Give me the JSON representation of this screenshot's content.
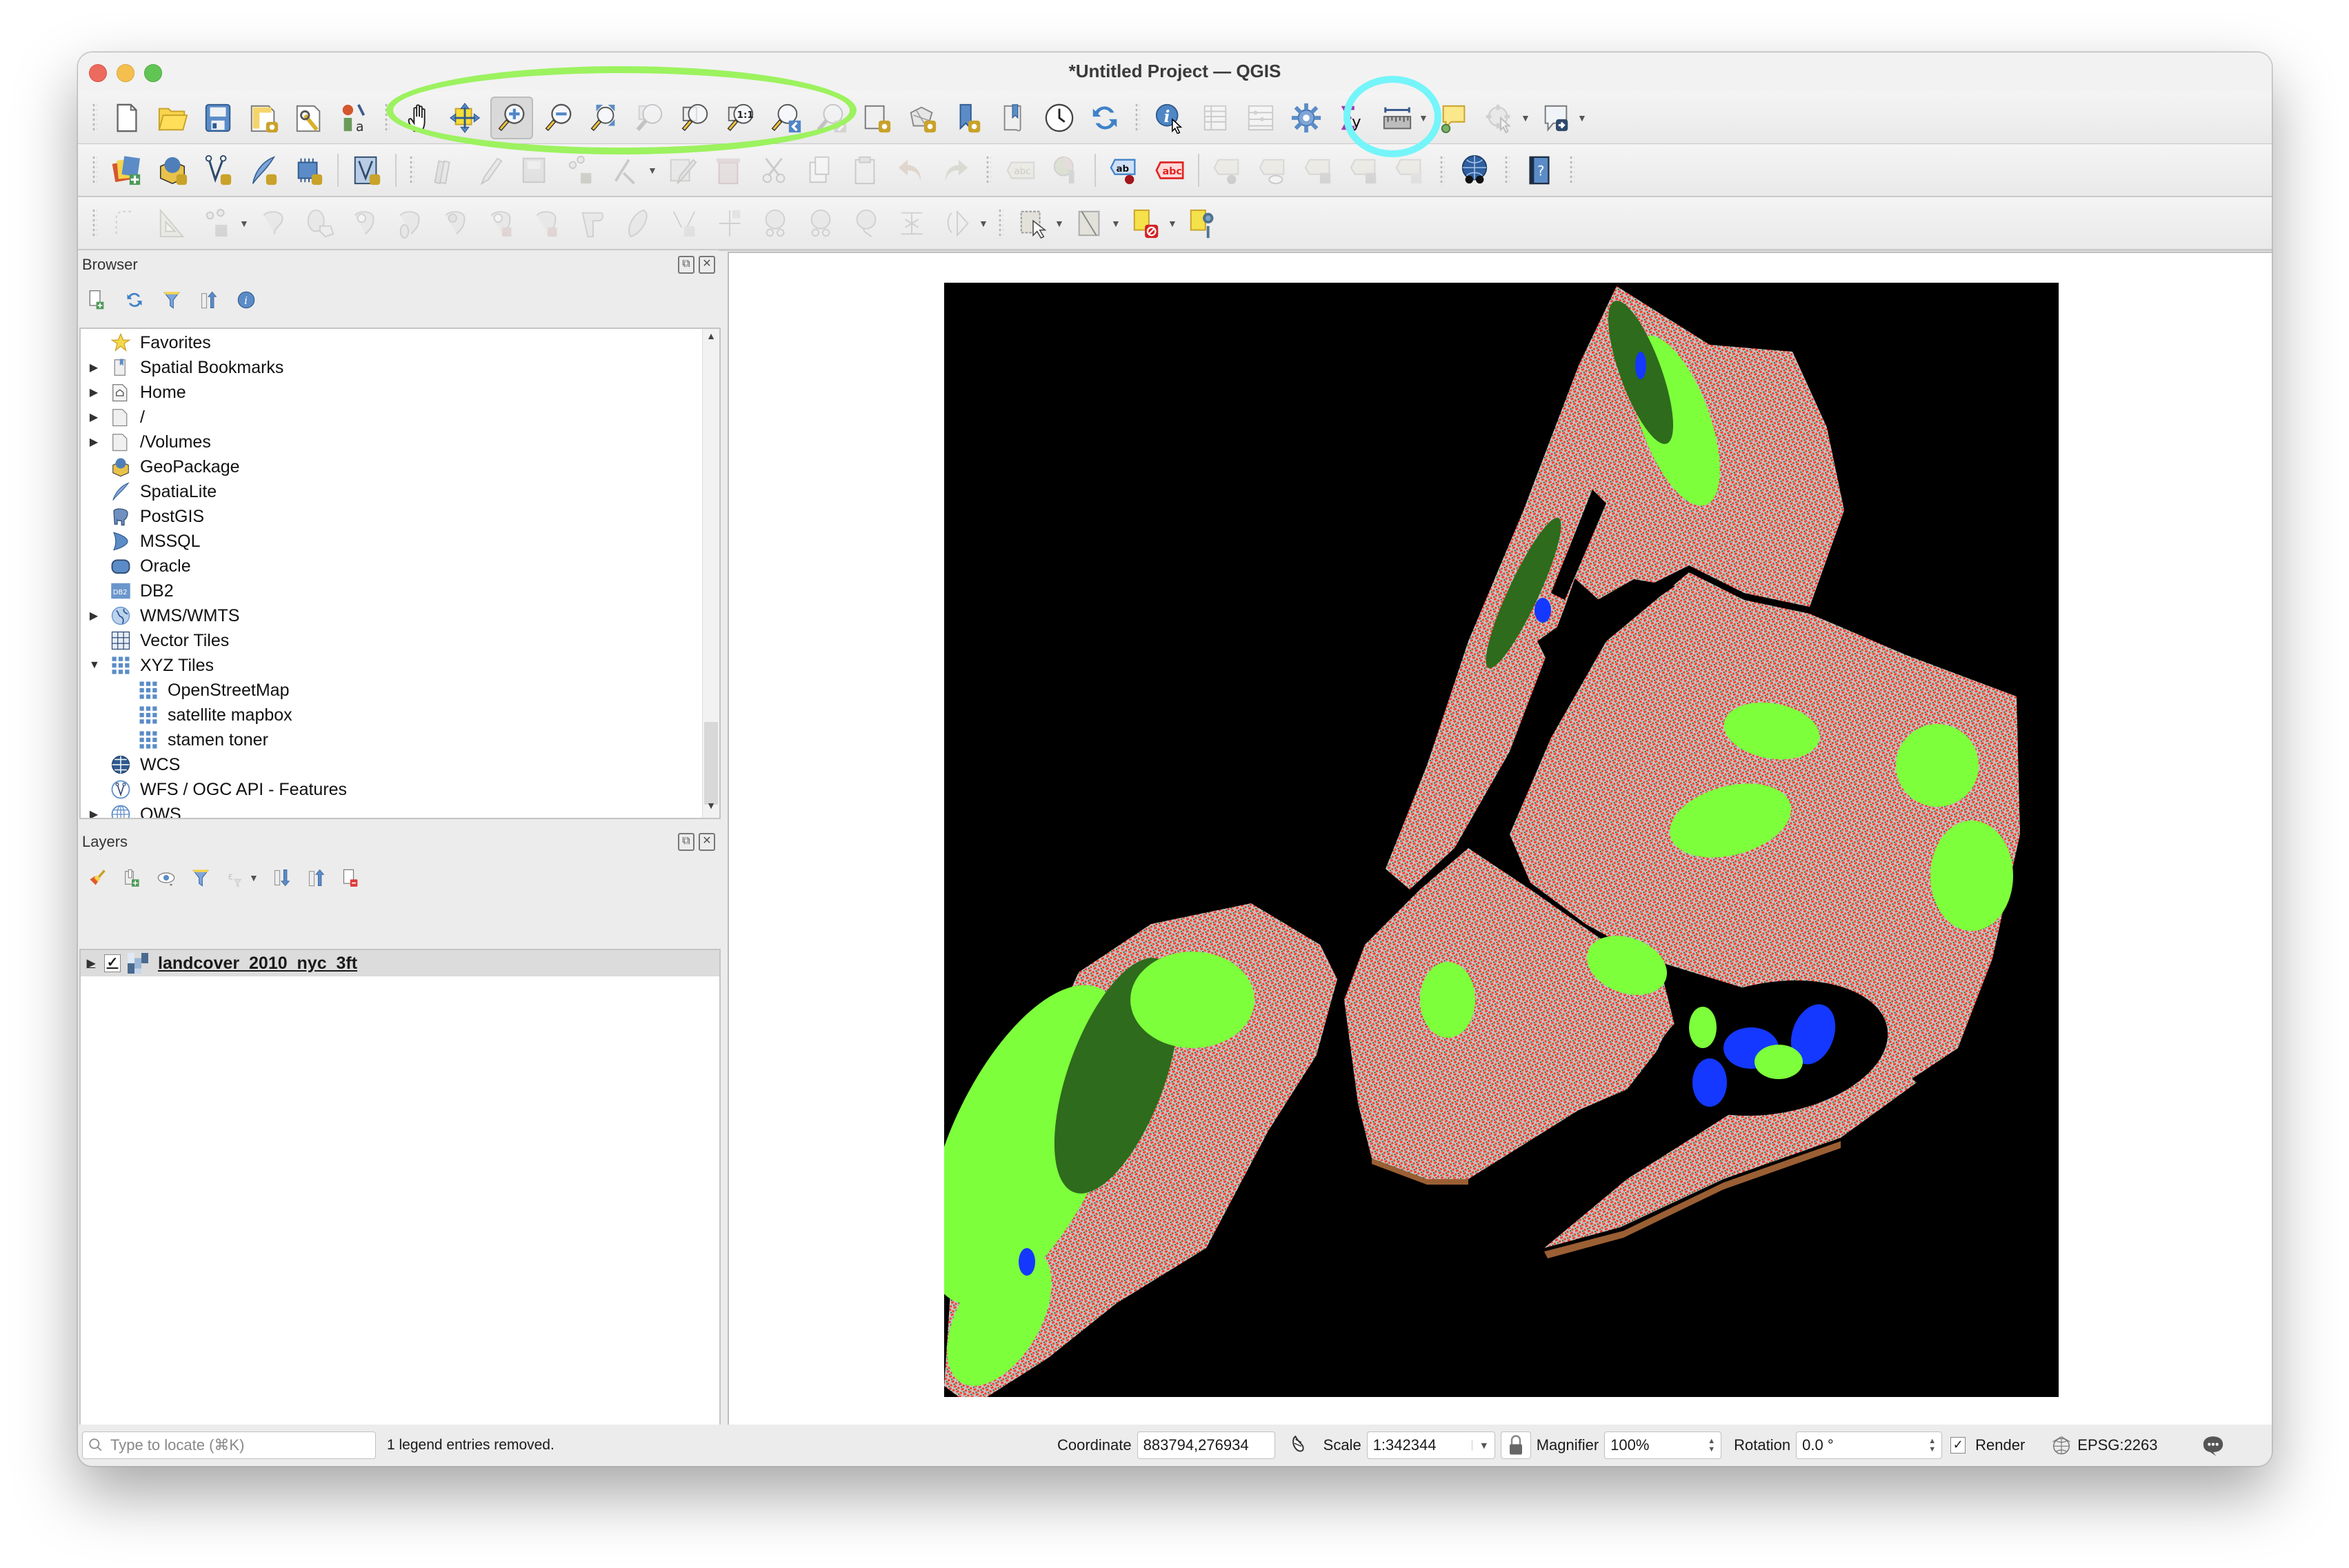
{
  "window": {
    "title": "*Untitled Project — QGIS"
  },
  "toolbar_row1": [
    {
      "name": "new-project",
      "label": "New Project"
    },
    {
      "name": "open-project",
      "label": "Open Project"
    },
    {
      "name": "save-project",
      "label": "Save Project"
    },
    {
      "name": "new-print-layout",
      "label": "New Print Layout"
    },
    {
      "name": "layout-manager",
      "label": "Layout Manager"
    },
    {
      "name": "style-manager",
      "label": "Style Manager"
    },
    {
      "name": "pan-map",
      "label": "Pan Map"
    },
    {
      "name": "pan-to-selection",
      "label": "Pan Map to Selection"
    },
    {
      "name": "zoom-in",
      "label": "Zoom In",
      "active": true
    },
    {
      "name": "zoom-out",
      "label": "Zoom Out"
    },
    {
      "name": "zoom-full",
      "label": "Zoom Full"
    },
    {
      "name": "zoom-to-selection",
      "label": "Zoom to Selection",
      "disabled": true
    },
    {
      "name": "zoom-to-layer",
      "label": "Zoom to Layer"
    },
    {
      "name": "zoom-native",
      "label": "Zoom to Native Resolution (1:1)"
    },
    {
      "name": "zoom-last",
      "label": "Zoom Last"
    },
    {
      "name": "zoom-next",
      "label": "Zoom Next",
      "disabled": true
    },
    {
      "name": "new-map-view",
      "label": "New Map View"
    },
    {
      "name": "new-3d-map-view",
      "label": "New 3D Map View"
    },
    {
      "name": "new-spatial-bookmark",
      "label": "New Spatial Bookmark"
    },
    {
      "name": "show-spatial-bookmarks",
      "label": "Show Spatial Bookmarks"
    },
    {
      "name": "temporal-controller",
      "label": "Temporal Controller"
    },
    {
      "name": "refresh",
      "label": "Refresh"
    },
    {
      "name": "identify-features",
      "label": "Identify Features"
    },
    {
      "name": "open-attribute-table",
      "label": "Open Attribute Table",
      "disabled": true
    },
    {
      "name": "field-calculator",
      "label": "Field Calculator",
      "disabled": true
    },
    {
      "name": "processing-toolbox",
      "label": "Toolbox"
    },
    {
      "name": "statistical-summary",
      "label": "Show Statistical Summary"
    },
    {
      "name": "measure-line",
      "label": "Measure Line"
    },
    {
      "name": "map-tips",
      "label": "Show Map Tips"
    },
    {
      "name": "run-feature-action",
      "label": "Run Feature Action",
      "disabled": true
    },
    {
      "name": "annotation",
      "label": "Text Annotation"
    }
  ],
  "annotations": {
    "green_circle_color": "#9cf25f",
    "cyan_circle_color": "#74f5f9"
  },
  "browser": {
    "title": "Browser",
    "tools": [
      "add-selected-layers",
      "refresh",
      "filter",
      "collapse-all",
      "properties"
    ],
    "items": [
      {
        "label": "Favorites",
        "icon": "star-icon",
        "expandable": false,
        "level": 0
      },
      {
        "label": "Spatial Bookmarks",
        "icon": "bookmark-icon",
        "expandable": true,
        "level": 0
      },
      {
        "label": "Home",
        "icon": "home-folder-icon",
        "expandable": true,
        "level": 0
      },
      {
        "label": "/",
        "icon": "folder-icon",
        "expandable": true,
        "level": 0
      },
      {
        "label": "/Volumes",
        "icon": "folder-icon",
        "expandable": true,
        "level": 0
      },
      {
        "label": "GeoPackage",
        "icon": "geopackage-icon",
        "expandable": false,
        "level": 0
      },
      {
        "label": "SpatiaLite",
        "icon": "spatialite-feather-icon",
        "expandable": false,
        "level": 0
      },
      {
        "label": "PostGIS",
        "icon": "postgis-elephant-icon",
        "expandable": false,
        "level": 0
      },
      {
        "label": "MSSQL",
        "icon": "mssql-icon",
        "expandable": false,
        "level": 0
      },
      {
        "label": "Oracle",
        "icon": "oracle-icon",
        "expandable": false,
        "level": 0
      },
      {
        "label": "DB2",
        "icon": "db2-icon",
        "expandable": false,
        "level": 0
      },
      {
        "label": "WMS/WMTS",
        "icon": "wms-globe-icon",
        "expandable": true,
        "level": 0
      },
      {
        "label": "Vector Tiles",
        "icon": "vector-tiles-icon",
        "expandable": false,
        "level": 0
      },
      {
        "label": "XYZ Tiles",
        "icon": "xyz-tiles-icon",
        "expandable": true,
        "expanded": true,
        "level": 0
      },
      {
        "label": "OpenStreetMap",
        "icon": "xyz-tile-icon",
        "expandable": false,
        "level": 1
      },
      {
        "label": "satellite mapbox",
        "icon": "xyz-tile-icon",
        "expandable": false,
        "level": 1
      },
      {
        "label": "stamen toner",
        "icon": "xyz-tile-icon",
        "expandable": false,
        "level": 1
      },
      {
        "label": "WCS",
        "icon": "wcs-globe-icon",
        "expandable": false,
        "level": 0
      },
      {
        "label": "WFS / OGC API - Features",
        "icon": "wfs-globe-icon",
        "expandable": false,
        "level": 0
      },
      {
        "label": "OWS",
        "icon": "ows-globe-icon",
        "expandable": true,
        "level": 0
      }
    ]
  },
  "layers": {
    "title": "Layers",
    "items": [
      {
        "label": "landcover_2010_nyc_3ft",
        "checked": true,
        "icon": "raster-layer-icon"
      }
    ]
  },
  "map": {
    "layer": "landcover_2010_nyc_3ft",
    "background": "#000000",
    "landcover_colors": {
      "tree_canopy": "#2e6b1c",
      "grass_shrub": "#7dff3c",
      "bare_soil": "#9b5f34",
      "water": "#1438ff",
      "buildings": "#ff3b2b",
      "roads_paved": "#c2c2c2"
    }
  },
  "status": {
    "locator_placeholder": "Type to locate (⌘K)",
    "message": "1 legend entries removed.",
    "coordinate_label": "Coordinate",
    "coordinate_value": "883794,276934",
    "scale_label": "Scale",
    "scale_value": "1:342344",
    "magnifier_label": "Magnifier",
    "magnifier_value": "100%",
    "rotation_label": "Rotation",
    "rotation_value": "0.0 °",
    "render_label": "Render",
    "render_checked": true,
    "crs": "EPSG:2263"
  }
}
